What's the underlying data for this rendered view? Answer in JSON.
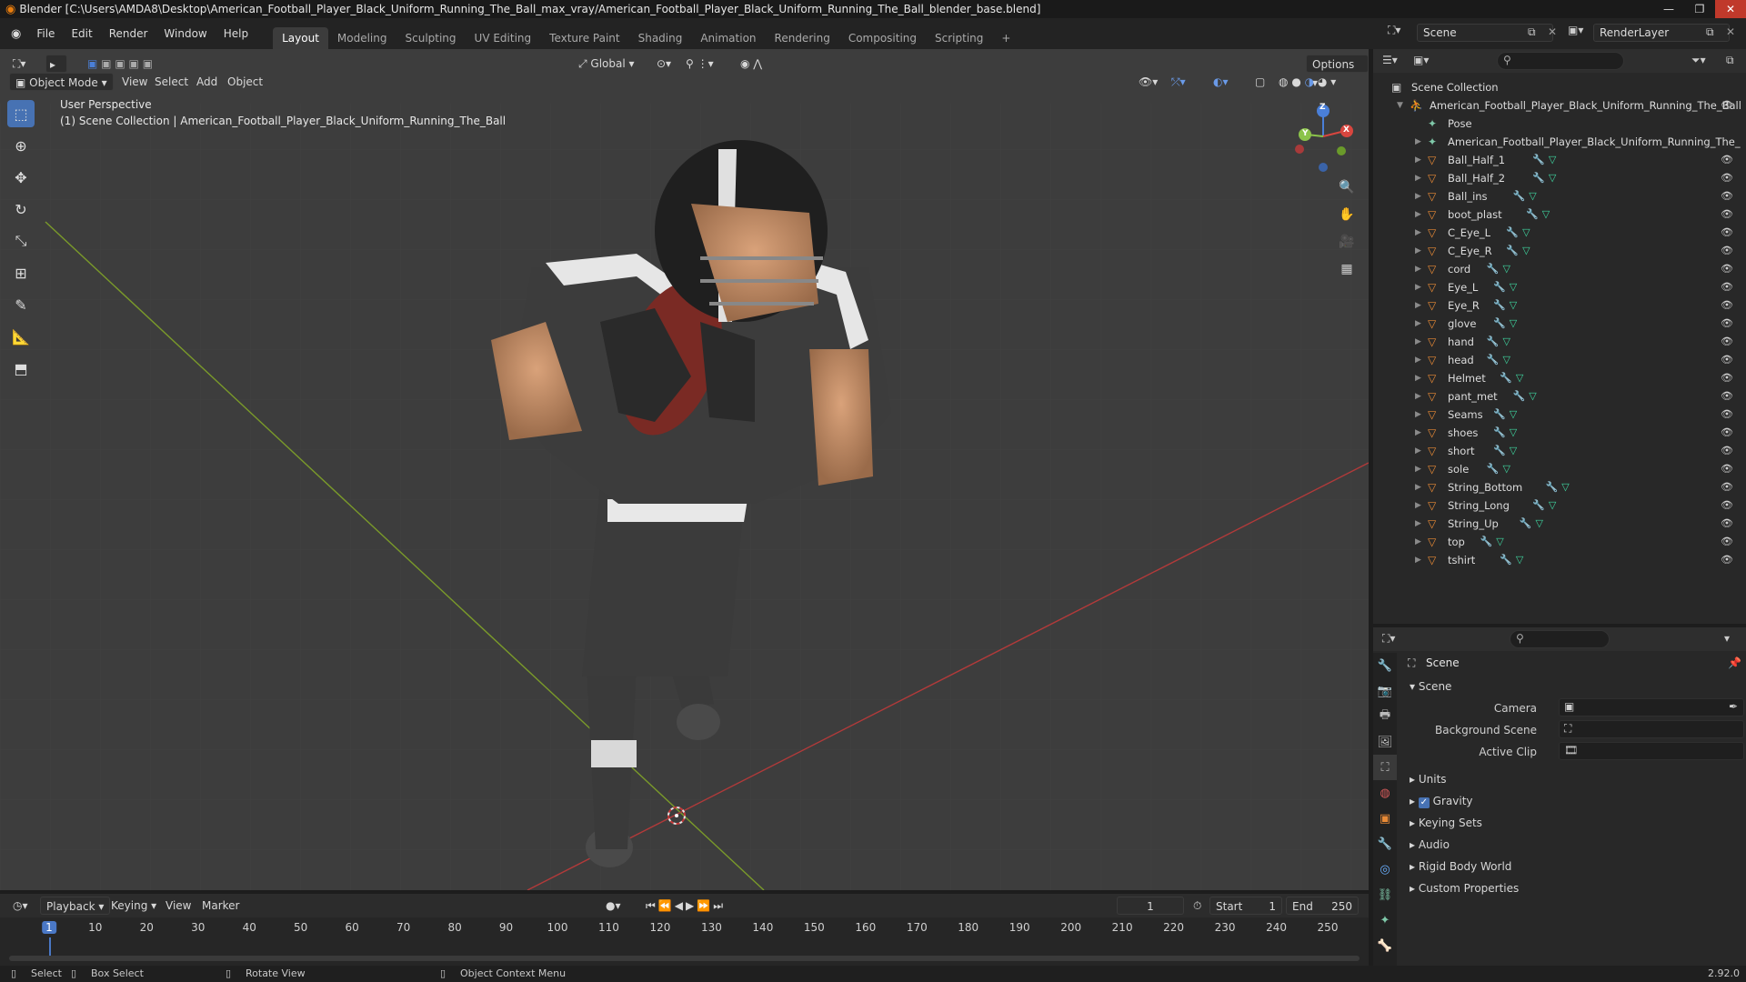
{
  "title_bar": {
    "text": "Blender [C:\\Users\\AMDA8\\Desktop\\American_Football_Player_Black_Uniform_Running_The_Ball_max_vray/American_Football_Player_Black_Uniform_Running_The_Ball_blender_base.blend]"
  },
  "menu": [
    "File",
    "Edit",
    "Render",
    "Window",
    "Help"
  ],
  "workspaces": [
    {
      "label": "Layout",
      "active": true
    },
    {
      "label": "Modeling"
    },
    {
      "label": "Sculpting"
    },
    {
      "label": "UV Editing"
    },
    {
      "label": "Texture Paint"
    },
    {
      "label": "Shading"
    },
    {
      "label": "Animation"
    },
    {
      "label": "Rendering"
    },
    {
      "label": "Compositing"
    },
    {
      "label": "Scripting"
    }
  ],
  "scene_name": "Scene",
  "render_layer": "RenderLayer",
  "viewport_header": {
    "mode": "Object Mode",
    "view": "View",
    "select": "Select",
    "add": "Add",
    "object": "Object",
    "transform_orientation": "Global",
    "options": "Options"
  },
  "viewport_info": {
    "perspective": "User Perspective",
    "collection": "(1) Scene Collection | American_Football_Player_Black_Uniform_Running_The_Ball"
  },
  "gizmo": {
    "x": "X",
    "y": "Y",
    "z": "Z"
  },
  "outliner": {
    "root": "Scene Collection",
    "armature": "American_Football_Player_Black_Uniform_Running_The_Ball",
    "pose": "Pose",
    "armature_data": "American_Football_Player_Black_Uniform_Running_The_",
    "objects": [
      "Ball_Half_1",
      "Ball_Half_2",
      "Ball_ins",
      "boot_plast",
      "C_Eye_L",
      "C_Eye_R",
      "cord",
      "Eye_L",
      "Eye_R",
      "glove",
      "hand",
      "head",
      "Helmet",
      "pant_met",
      "Seams",
      "shoes",
      "short",
      "sole",
      "String_Bottom",
      "String_Long",
      "String_Up",
      "top",
      "tshirt"
    ]
  },
  "properties": {
    "context": "Scene",
    "section": "Scene",
    "camera_label": "Camera",
    "background_scene_label": "Background Scene",
    "active_clip_label": "Active Clip",
    "panels": [
      {
        "label": "Units"
      },
      {
        "label": "Gravity",
        "checkbox": true
      },
      {
        "label": "Keying Sets"
      },
      {
        "label": "Audio"
      },
      {
        "label": "Rigid Body World"
      },
      {
        "label": "Custom Properties"
      }
    ]
  },
  "timeline": {
    "playback": "Playback",
    "keying": "Keying",
    "view": "View",
    "marker": "Marker",
    "current_frame": "1",
    "start_label": "Start",
    "start": "1",
    "end_label": "End",
    "end": "250",
    "ticks": [
      "1",
      "10",
      "20",
      "30",
      "40",
      "50",
      "60",
      "70",
      "80",
      "90",
      "100",
      "110",
      "120",
      "130",
      "140",
      "150",
      "160",
      "170",
      "180",
      "190",
      "200",
      "210",
      "220",
      "230",
      "240",
      "250"
    ]
  },
  "status_bar": {
    "select": "Select",
    "box_select": "Box Select",
    "rotate_view": "Rotate View",
    "context_menu": "Object Context Menu",
    "version": "2.92.0"
  }
}
